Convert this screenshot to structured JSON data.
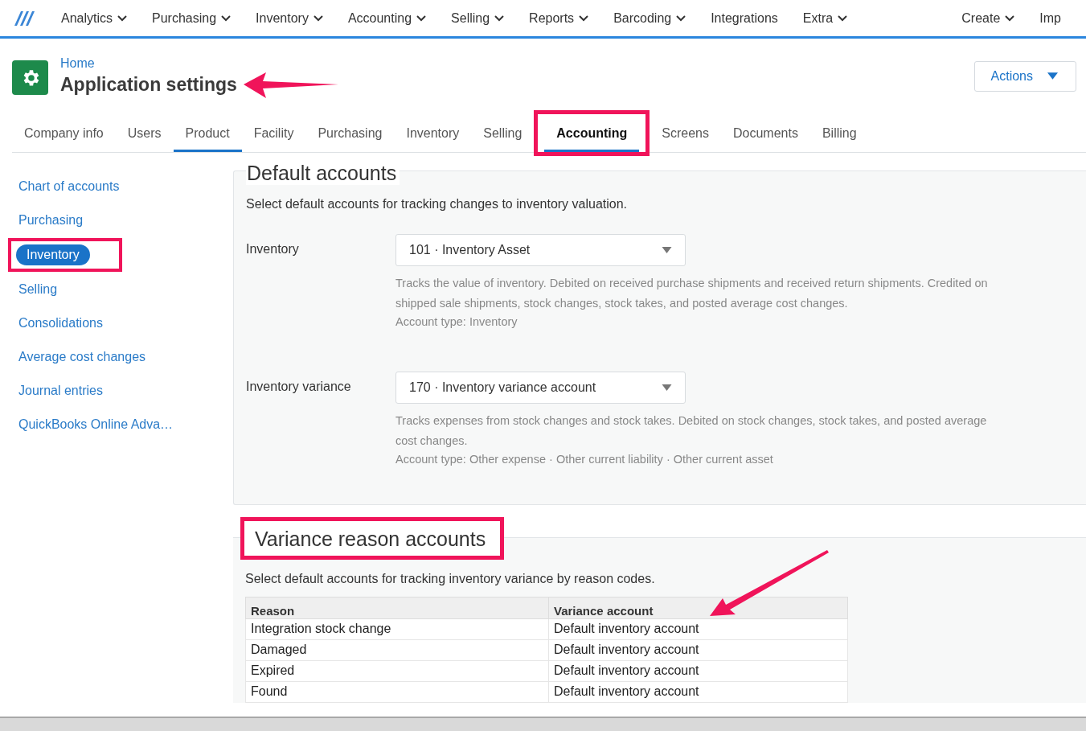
{
  "top_nav": {
    "items": [
      {
        "label": "Analytics",
        "dropdown": true
      },
      {
        "label": "Purchasing",
        "dropdown": true
      },
      {
        "label": "Inventory",
        "dropdown": true
      },
      {
        "label": "Accounting",
        "dropdown": true
      },
      {
        "label": "Selling",
        "dropdown": true
      },
      {
        "label": "Reports",
        "dropdown": true
      },
      {
        "label": "Barcoding",
        "dropdown": true
      },
      {
        "label": "Integrations",
        "dropdown": false
      },
      {
        "label": "Extra",
        "dropdown": true
      }
    ],
    "right_items": [
      {
        "label": "Create",
        "dropdown": true
      },
      {
        "label": "Imp",
        "dropdown": false
      }
    ]
  },
  "header": {
    "breadcrumb": "Home",
    "title": "Application settings",
    "title_annotated": true,
    "actions_button": "Actions"
  },
  "tabs": [
    {
      "label": "Company info",
      "selected": false,
      "underlined": false,
      "highlighted": false
    },
    {
      "label": "Users",
      "selected": false,
      "underlined": false,
      "highlighted": false
    },
    {
      "label": "Product",
      "selected": false,
      "underlined": true,
      "highlighted": false
    },
    {
      "label": "Facility",
      "selected": false,
      "underlined": false,
      "highlighted": false
    },
    {
      "label": "Purchasing",
      "selected": false,
      "underlined": false,
      "highlighted": false
    },
    {
      "label": "Inventory",
      "selected": false,
      "underlined": false,
      "highlighted": false
    },
    {
      "label": "Selling",
      "selected": false,
      "underlined": false,
      "highlighted": false
    },
    {
      "label": "Accounting",
      "selected": true,
      "underlined": true,
      "highlighted": true
    },
    {
      "label": "Screens",
      "selected": false,
      "underlined": false,
      "highlighted": false
    },
    {
      "label": "Documents",
      "selected": false,
      "underlined": false,
      "highlighted": false
    },
    {
      "label": "Billing",
      "selected": false,
      "underlined": false,
      "highlighted": false
    }
  ],
  "sidebar": {
    "items": [
      {
        "label": "Chart of accounts",
        "selected": false,
        "highlighted": false
      },
      {
        "label": "Purchasing",
        "selected": false,
        "highlighted": false
      },
      {
        "label": "Inventory",
        "selected": true,
        "highlighted": true
      },
      {
        "label": "Selling",
        "selected": false,
        "highlighted": false
      },
      {
        "label": "Consolidations",
        "selected": false,
        "highlighted": false
      },
      {
        "label": "Average cost changes",
        "selected": false,
        "highlighted": false
      },
      {
        "label": "Journal entries",
        "selected": false,
        "highlighted": false
      },
      {
        "label": "QuickBooks Online Adva…",
        "selected": false,
        "highlighted": false
      }
    ]
  },
  "default_accounts": {
    "heading": "Default accounts",
    "description": "Select default accounts for tracking changes to inventory valuation.",
    "fields": [
      {
        "label": "Inventory",
        "value": "101 · Inventory Asset",
        "help": "Tracks the value of inventory. Debited on received purchase shipments and received return shipments. Credited on shipped sale shipments, stock changes, stock takes, and posted average cost changes.",
        "account_type": "Account type: Inventory"
      },
      {
        "label": "Inventory variance",
        "value": "170 · Inventory variance account",
        "help": "Tracks expenses from stock changes and stock takes. Debited on stock changes, stock takes, and posted average cost changes.",
        "account_type": "Account type: Other expense · Other current liability · Other current asset"
      }
    ]
  },
  "variance_reason_accounts": {
    "heading": "Variance reason accounts",
    "heading_highlighted": true,
    "description": "Select default accounts for tracking inventory variance by reason codes.",
    "columns": [
      "Reason",
      "Variance account"
    ],
    "rows": [
      [
        "Integration stock change",
        "Default inventory account"
      ],
      [
        "Damaged",
        "Default inventory account"
      ],
      [
        "Expired",
        "Default inventory account"
      ],
      [
        "Found",
        "Default inventory account"
      ]
    ],
    "column_annotated": true
  }
}
